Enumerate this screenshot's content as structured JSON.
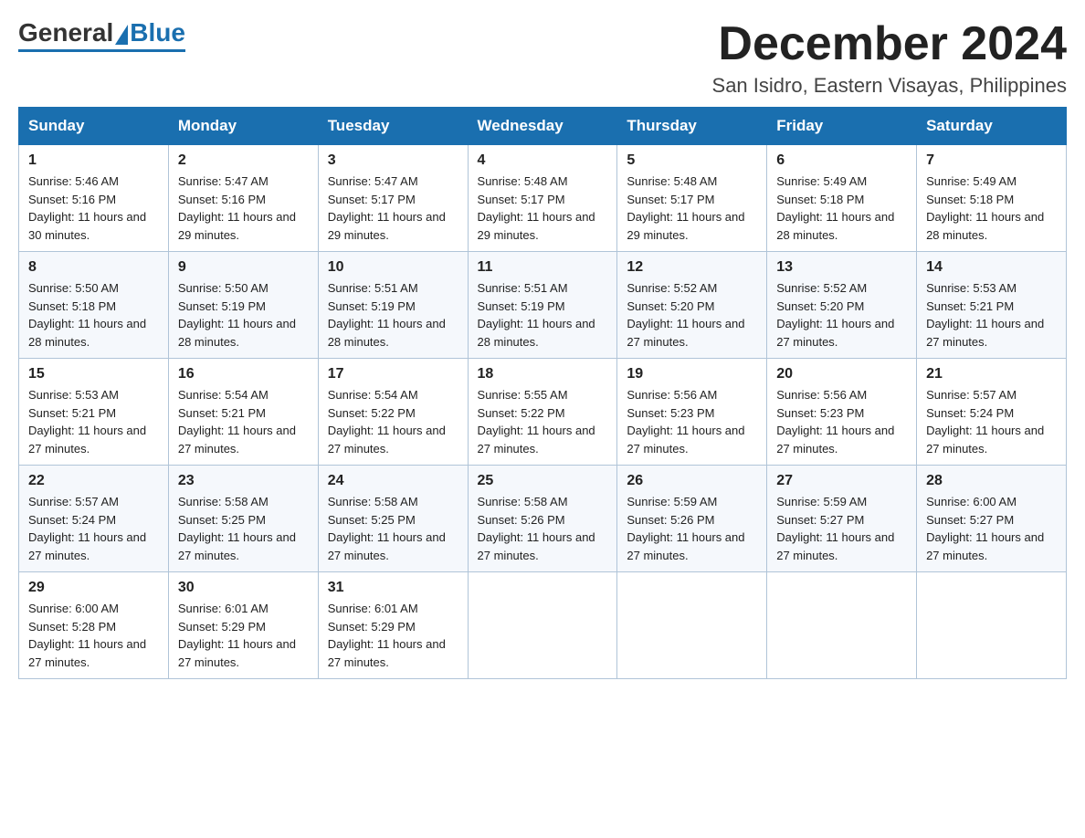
{
  "header": {
    "logo_general": "General",
    "logo_blue": "Blue",
    "month_title": "December 2024",
    "location": "San Isidro, Eastern Visayas, Philippines"
  },
  "days_of_week": [
    "Sunday",
    "Monday",
    "Tuesday",
    "Wednesday",
    "Thursday",
    "Friday",
    "Saturday"
  ],
  "weeks": [
    [
      {
        "day": "1",
        "sunrise": "5:46 AM",
        "sunset": "5:16 PM",
        "daylight": "11 hours and 30 minutes."
      },
      {
        "day": "2",
        "sunrise": "5:47 AM",
        "sunset": "5:16 PM",
        "daylight": "11 hours and 29 minutes."
      },
      {
        "day": "3",
        "sunrise": "5:47 AM",
        "sunset": "5:17 PM",
        "daylight": "11 hours and 29 minutes."
      },
      {
        "day": "4",
        "sunrise": "5:48 AM",
        "sunset": "5:17 PM",
        "daylight": "11 hours and 29 minutes."
      },
      {
        "day": "5",
        "sunrise": "5:48 AM",
        "sunset": "5:17 PM",
        "daylight": "11 hours and 29 minutes."
      },
      {
        "day": "6",
        "sunrise": "5:49 AM",
        "sunset": "5:18 PM",
        "daylight": "11 hours and 28 minutes."
      },
      {
        "day": "7",
        "sunrise": "5:49 AM",
        "sunset": "5:18 PM",
        "daylight": "11 hours and 28 minutes."
      }
    ],
    [
      {
        "day": "8",
        "sunrise": "5:50 AM",
        "sunset": "5:18 PM",
        "daylight": "11 hours and 28 minutes."
      },
      {
        "day": "9",
        "sunrise": "5:50 AM",
        "sunset": "5:19 PM",
        "daylight": "11 hours and 28 minutes."
      },
      {
        "day": "10",
        "sunrise": "5:51 AM",
        "sunset": "5:19 PM",
        "daylight": "11 hours and 28 minutes."
      },
      {
        "day": "11",
        "sunrise": "5:51 AM",
        "sunset": "5:19 PM",
        "daylight": "11 hours and 28 minutes."
      },
      {
        "day": "12",
        "sunrise": "5:52 AM",
        "sunset": "5:20 PM",
        "daylight": "11 hours and 27 minutes."
      },
      {
        "day": "13",
        "sunrise": "5:52 AM",
        "sunset": "5:20 PM",
        "daylight": "11 hours and 27 minutes."
      },
      {
        "day": "14",
        "sunrise": "5:53 AM",
        "sunset": "5:21 PM",
        "daylight": "11 hours and 27 minutes."
      }
    ],
    [
      {
        "day": "15",
        "sunrise": "5:53 AM",
        "sunset": "5:21 PM",
        "daylight": "11 hours and 27 minutes."
      },
      {
        "day": "16",
        "sunrise": "5:54 AM",
        "sunset": "5:21 PM",
        "daylight": "11 hours and 27 minutes."
      },
      {
        "day": "17",
        "sunrise": "5:54 AM",
        "sunset": "5:22 PM",
        "daylight": "11 hours and 27 minutes."
      },
      {
        "day": "18",
        "sunrise": "5:55 AM",
        "sunset": "5:22 PM",
        "daylight": "11 hours and 27 minutes."
      },
      {
        "day": "19",
        "sunrise": "5:56 AM",
        "sunset": "5:23 PM",
        "daylight": "11 hours and 27 minutes."
      },
      {
        "day": "20",
        "sunrise": "5:56 AM",
        "sunset": "5:23 PM",
        "daylight": "11 hours and 27 minutes."
      },
      {
        "day": "21",
        "sunrise": "5:57 AM",
        "sunset": "5:24 PM",
        "daylight": "11 hours and 27 minutes."
      }
    ],
    [
      {
        "day": "22",
        "sunrise": "5:57 AM",
        "sunset": "5:24 PM",
        "daylight": "11 hours and 27 minutes."
      },
      {
        "day": "23",
        "sunrise": "5:58 AM",
        "sunset": "5:25 PM",
        "daylight": "11 hours and 27 minutes."
      },
      {
        "day": "24",
        "sunrise": "5:58 AM",
        "sunset": "5:25 PM",
        "daylight": "11 hours and 27 minutes."
      },
      {
        "day": "25",
        "sunrise": "5:58 AM",
        "sunset": "5:26 PM",
        "daylight": "11 hours and 27 minutes."
      },
      {
        "day": "26",
        "sunrise": "5:59 AM",
        "sunset": "5:26 PM",
        "daylight": "11 hours and 27 minutes."
      },
      {
        "day": "27",
        "sunrise": "5:59 AM",
        "sunset": "5:27 PM",
        "daylight": "11 hours and 27 minutes."
      },
      {
        "day": "28",
        "sunrise": "6:00 AM",
        "sunset": "5:27 PM",
        "daylight": "11 hours and 27 minutes."
      }
    ],
    [
      {
        "day": "29",
        "sunrise": "6:00 AM",
        "sunset": "5:28 PM",
        "daylight": "11 hours and 27 minutes."
      },
      {
        "day": "30",
        "sunrise": "6:01 AM",
        "sunset": "5:29 PM",
        "daylight": "11 hours and 27 minutes."
      },
      {
        "day": "31",
        "sunrise": "6:01 AM",
        "sunset": "5:29 PM",
        "daylight": "11 hours and 27 minutes."
      },
      null,
      null,
      null,
      null
    ]
  ]
}
